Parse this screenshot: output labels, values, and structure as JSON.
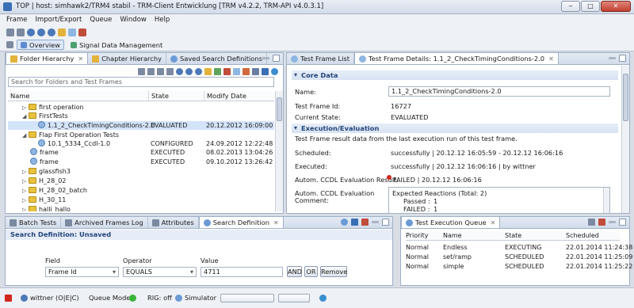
{
  "window": {
    "title": "TOP | host: simhawk2/TRM4 stabil - TRM-Client Entwicklung [TRM v4.2.2, TRM-API v4.0.3.1]",
    "min": "‒",
    "max": "□",
    "close": "✕"
  },
  "menu": [
    "Frame",
    "Import/Export",
    "Queue",
    "Window",
    "Help"
  ],
  "perspectives": {
    "overview": "Overview",
    "signal": "Signal Data Management"
  },
  "left_panel": {
    "tabs": [
      "Folder Hierarchy",
      "Chapter Hierarchy",
      "Saved Search Definitions"
    ],
    "search_placeholder": "Search for Folders and Test Frames",
    "columns": [
      "Name",
      "State",
      "Modify Date"
    ],
    "rows": [
      {
        "name": "first operation",
        "state": "",
        "date": ""
      },
      {
        "name": "FirstTests",
        "state": "",
        "date": ""
      },
      {
        "name": "1.1_2_CheckTimingConditions-2.0",
        "state": "EVALUATED",
        "date": "20.12.2012 16:09:00"
      },
      {
        "name": "Flap First Operation Tests",
        "state": "",
        "date": ""
      },
      {
        "name": "10.1_5334_Ccdl-1.0",
        "state": "CONFIGURED",
        "date": "24.09.2012 12:22:48"
      },
      {
        "name": "frame",
        "state": "EXECUTED",
        "date": "08.02.2013 13:04:26"
      },
      {
        "name": "frame",
        "state": "EXECUTED",
        "date": "09.10.2012 13:26:42"
      },
      {
        "name": "glassfish3",
        "state": "",
        "date": ""
      },
      {
        "name": "H_28_02",
        "state": "",
        "date": ""
      },
      {
        "name": "H_28_02_batch",
        "state": "",
        "date": ""
      },
      {
        "name": "H_30_11",
        "state": "",
        "date": ""
      },
      {
        "name": "halli_hallo",
        "state": "",
        "date": ""
      }
    ]
  },
  "right_panel": {
    "tabs": [
      "Test Frame List",
      "Test Frame Details: 1.1_2_CheckTimingConditions-2.0"
    ],
    "core_data": {
      "heading": "Core Data",
      "name_label": "Name:",
      "name_value": "1.1_2_CheckTimingConditions-2.0",
      "id_label": "Test Frame Id:",
      "id_value": "16727",
      "state_label": "Current State:",
      "state_value": "EVALUATED"
    },
    "execution": {
      "heading": "Execution/Evaluation",
      "description": "Test Frame result data from the last execution run of this test frame.",
      "scheduled_label": "Scheduled:",
      "scheduled_value": "successfully | 20.12.12 16:05:59 - 20.12.12 16:06:16",
      "executed_label": "Executed:",
      "executed_value": "successfully | 20.12.12 16:06:16 | by wittner",
      "autom_label": "Autom. CCDL Evaluation Result:",
      "autom_value": "FAILED | 20.12.12 16:06:16",
      "comment_label_1": "Autom. CCDL Evaluation",
      "comment_label_2": "Comment:",
      "comment_line1": "Expected Reactions (Total: 2)",
      "comment_passed_label": "Passed :",
      "comment_passed_value": "1",
      "comment_failed_label": "FAILED :",
      "comment_failed_value": "1"
    }
  },
  "bottom_left": {
    "tabs": [
      "Batch Tests",
      "Archived Frames Log",
      "Attributes",
      "Search Definition"
    ],
    "heading": "Search Definition: Unsaved",
    "field_label": "Field",
    "operator_label": "Operator",
    "value_label": "Value",
    "field_value": "Frame Id",
    "operator_value": "EQUALS",
    "value_value": "4711",
    "and": "AND",
    "or": "OR",
    "remove": "Remove"
  },
  "bottom_right": {
    "tab": "Test Execution Queue",
    "columns": [
      "Priority",
      "Name",
      "State",
      "Scheduled"
    ],
    "rows": [
      {
        "priority": "Normal",
        "name": "Endless",
        "state": "EXECUTING",
        "scheduled": "22.01.2014 11:24:38"
      },
      {
        "priority": "Normal",
        "name": "set/ramp",
        "state": "SCHEDULED",
        "scheduled": "22.01.2014 11:25:09"
      },
      {
        "priority": "Normal",
        "name": "simple",
        "state": "SCHEDULED",
        "scheduled": "22.01.2014 11:25:22"
      }
    ]
  },
  "status": {
    "user": "wittner (O|E|C)",
    "queue_mode": "Queue Mode:",
    "rig": "RIG: off",
    "simulator": "Simulator"
  },
  "colors": {
    "accent": "#3a6fb5",
    "section_text": "#23457a",
    "failed": "#d0281c",
    "selection": "#d3e3f8",
    "queue_mode_led": "#3bb33b"
  }
}
